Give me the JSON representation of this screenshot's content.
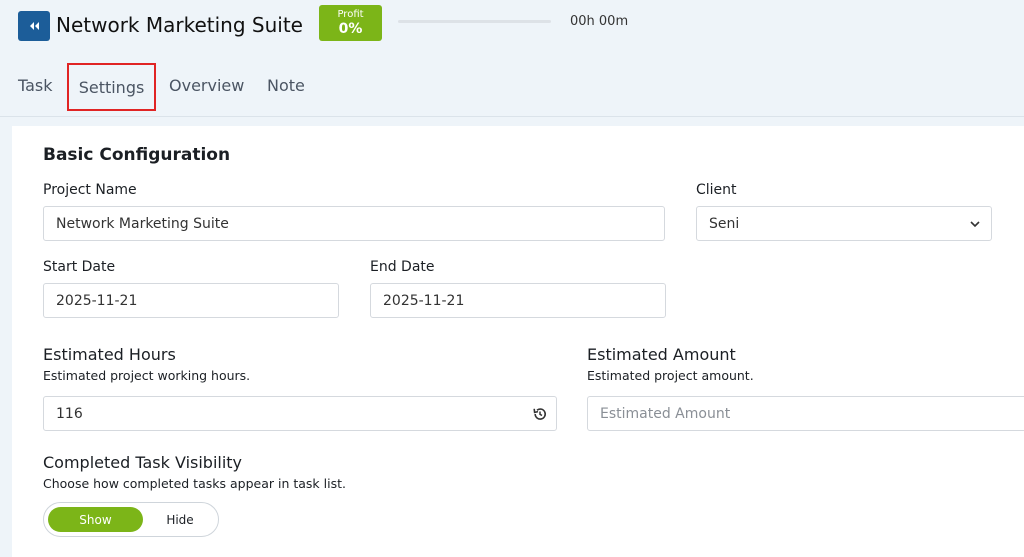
{
  "header": {
    "title": "Network Marketing Suite",
    "profit_label": "Profit",
    "profit_value": "0%",
    "timer": "00h 00m",
    "progress": 0
  },
  "tabs": [
    {
      "label": "Task"
    },
    {
      "label": "Settings",
      "active": true
    },
    {
      "label": "Overview"
    },
    {
      "label": "Note"
    }
  ],
  "basic_config": {
    "title": "Basic Configuration",
    "project_name_label": "Project Name",
    "project_name_value": "Network Marketing Suite",
    "client_label": "Client",
    "client_value": "Seni",
    "start_date_label": "Start Date",
    "start_date_value": "2025-11-21",
    "end_date_label": "End Date",
    "end_date_value": "2025-11-21"
  },
  "estimates": {
    "hours_label": "Estimated Hours",
    "hours_hint": "Estimated project working hours.",
    "hours_value": "116",
    "amount_label": "Estimated Amount",
    "amount_hint": "Estimated project amount.",
    "amount_placeholder": "Estimated Amount"
  },
  "visibility": {
    "title": "Completed Task Visibility",
    "hint": "Choose how completed tasks appear in task list.",
    "show_label": "Show",
    "hide_label": "Hide",
    "selected": "Show"
  },
  "colors": {
    "accent_green": "#7cb518",
    "brand_blue": "#1c5d99",
    "highlight_red": "#e02424"
  },
  "icons": {
    "back": "double-chevron-left-icon",
    "dropdown": "chevron-down-icon",
    "reset": "history-reset-icon"
  }
}
